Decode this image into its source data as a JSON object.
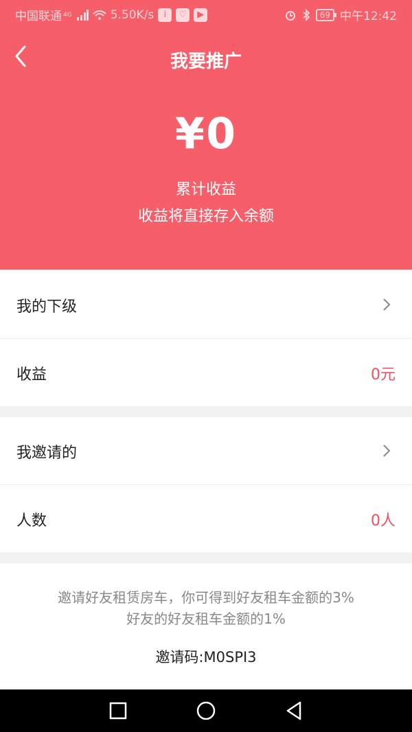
{
  "status_bar": {
    "carrier": "中国联通",
    "network_badge": "4G",
    "speed": "5.50K/s",
    "battery": "69",
    "time": "中午12:42",
    "icons": [
      "signal-icon",
      "wifi-icon",
      "notification-i-icon",
      "shield-icon",
      "video-icon",
      "alarm-icon",
      "bluetooth-icon",
      "battery-icon"
    ]
  },
  "header": {
    "title": "我要推广",
    "amount": "¥0",
    "subtitle_1": "累计收益",
    "subtitle_2": "收益将直接存入余额",
    "background_color": "#f65e6a"
  },
  "section_1": {
    "row_1_label": "我的下级",
    "row_2_label": "收益",
    "row_2_value": "0元"
  },
  "section_2": {
    "row_1_label": "我邀请的",
    "row_2_label": "人数",
    "row_2_value": "0人"
  },
  "invite": {
    "line_1": "邀请好友租赁房车，你可得到好友租车金额的3%",
    "line_2": "好友的好友租车金额的1%",
    "code_label": "邀请码:",
    "code_value": "M0SPI3"
  },
  "colors": {
    "accent": "#f65e6a",
    "value_red": "#f0505e"
  }
}
